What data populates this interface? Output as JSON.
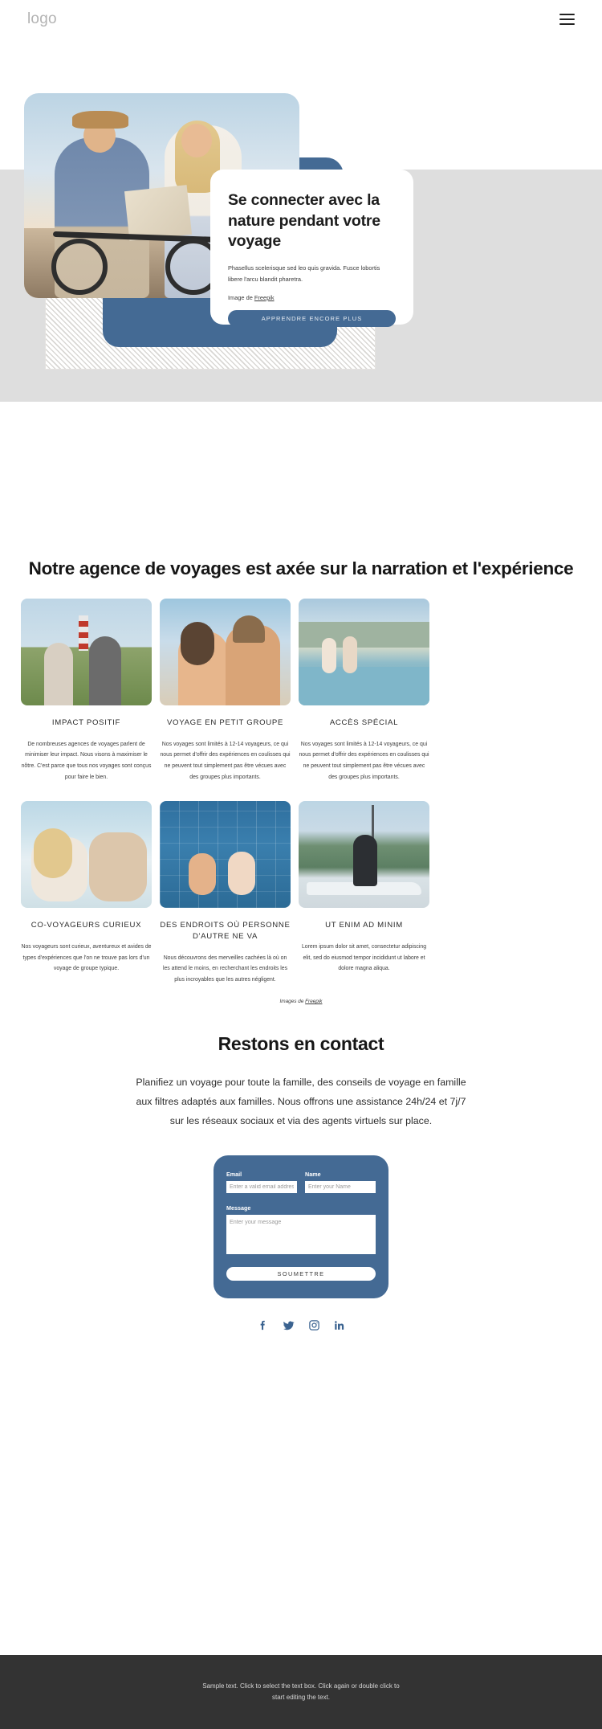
{
  "header": {
    "logo": "logo",
    "menu_icon": "hamburger-menu-icon"
  },
  "hero": {
    "title": "Se connecter avec la nature pendant votre voyage",
    "paragraph": "Phasellus scelerisque sed leo quis gravida. Fusce lobortis libere l'arcu blandit pharetra.",
    "credit_prefix": "Image de ",
    "credit_link": "Freepik",
    "cta_label": "APPRENDRE ENCORE PLUS",
    "accent_color": "#446a94",
    "band_color": "#dedede"
  },
  "features": {
    "title": "Notre agence de voyages est axée sur la narration et l'expérience",
    "credit_prefix": "Images de ",
    "credit_link": "Freepik",
    "cards": [
      {
        "title": "IMPACT POSITIF",
        "text": "De nombreuses agences de voyages parlent de minimiser leur impact. Nous visons à maximiser le nôtre. C'est parce que tous nos voyages sont conçus pour faire le bien.",
        "photo": "lighthouse-couple-photo"
      },
      {
        "title": "VOYAGE EN PETIT GROUPE",
        "text": "Nos voyages sont limités à 12-14 voyageurs, ce qui nous permet d'offrir des expériences en coulisses qui ne peuvent tout simplement pas être vécues avec des groupes plus importants.",
        "photo": "selfie-couple-photo"
      },
      {
        "title": "ACCÈS SPÉCIAL",
        "text": "Nos voyages sont limités à 12-14 voyageurs, ce qui nous permet d'offrir des expériences en coulisses qui ne peuvent tout simplement pas être vécues avec des groupes plus importants.",
        "photo": "infinity-pool-photo"
      },
      {
        "title": "CO-VOYAGEURS CURIEUX",
        "text": "Nos voyageurs sont curieux, aventureux et avides de types d'expériences que l'on ne trouve pas lors d'un voyage de groupe typique.",
        "photo": "poolside-couple-photo"
      },
      {
        "title": "DES ENDROITS OÙ PERSONNE D'AUTRE NE VA",
        "text": "Nous découvrons des merveilles cachées là où on les attend le moins, en recherchant les endroits les plus incroyables que les autres négligent.",
        "photo": "pool-friends-photo"
      },
      {
        "title": "UT ENIM AD MINIM",
        "text": "Lorem ipsum dolor sit amet, consectetur adipiscing elit, sed do eiusmod tempor incididunt ut labore et dolore magna aliqua.",
        "photo": "sailboat-woman-photo"
      }
    ]
  },
  "contact": {
    "title": "Restons en contact",
    "paragraph": "Planifiez un voyage pour toute la famille, des conseils de voyage en famille aux filtres adaptés aux familles. Nous offrons une assistance 24h/24 et 7j/7 sur les réseaux sociaux et via des agents virtuels sur place.",
    "form": {
      "email_label": "Email",
      "email_placeholder": "Enter a valid email address",
      "email_value": "",
      "name_label": "Name",
      "name_placeholder": "Enter your Name",
      "name_value": "",
      "message_label": "Message",
      "message_placeholder": "Enter your message",
      "message_value": "",
      "submit_label": "SOUMETTRE"
    },
    "socials": [
      {
        "name": "facebook-icon"
      },
      {
        "name": "twitter-icon"
      },
      {
        "name": "instagram-icon"
      },
      {
        "name": "linkedin-icon"
      }
    ],
    "social_color": "#3b6390"
  },
  "footer": {
    "text": "Sample text. Click to select the text box. Click again or double click to start editing the text.",
    "background": "#333333"
  }
}
